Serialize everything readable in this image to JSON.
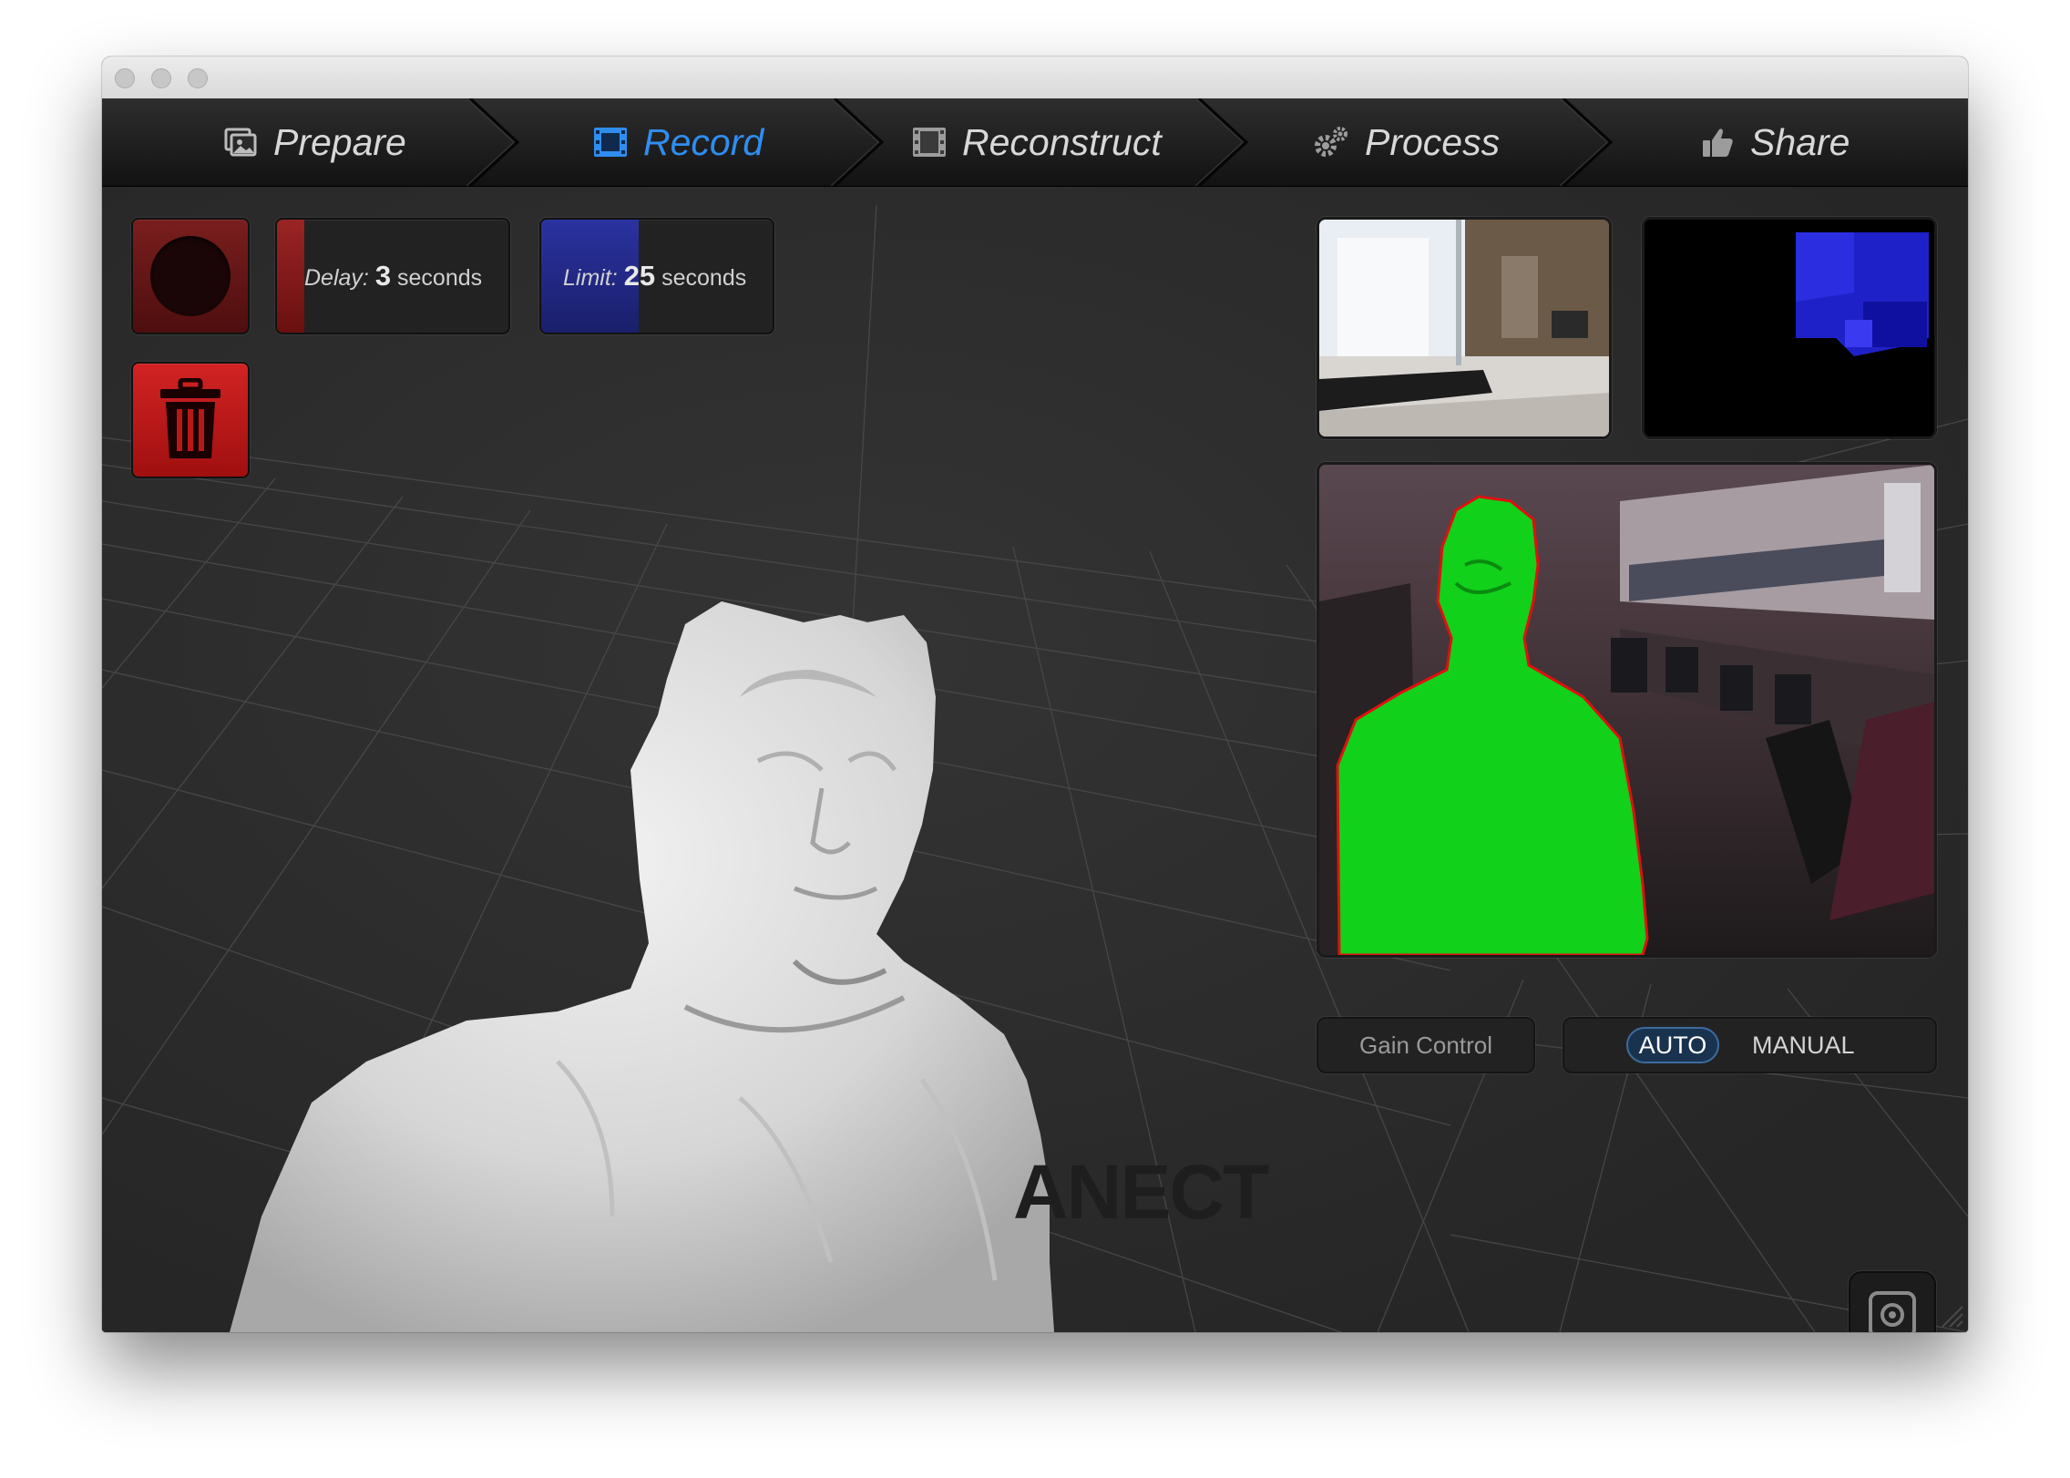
{
  "window": {
    "traffic_lights": [
      "close",
      "minimize",
      "zoom"
    ]
  },
  "tabs": [
    {
      "label": "Prepare",
      "icon": "photos-icon",
      "active": false
    },
    {
      "label": "Record",
      "icon": "film-frame-icon",
      "active": true
    },
    {
      "label": "Reconstruct",
      "icon": "film-strip-icon",
      "active": false
    },
    {
      "label": "Process",
      "icon": "gears-icon",
      "active": false
    },
    {
      "label": "Share",
      "icon": "thumbs-up-icon",
      "active": false
    }
  ],
  "controls": {
    "record_button": {
      "icon": "record-icon",
      "color": "#7a1e1e"
    },
    "delete_button": {
      "icon": "trash-icon",
      "color": "#d22323"
    },
    "delay": {
      "label": "Delay:",
      "value": "3",
      "unit": "seconds",
      "fill_fraction": 0.12,
      "color": "#8a1e1e"
    },
    "limit": {
      "label": "Limit:",
      "value": "25",
      "unit": "seconds",
      "fill_fraction": 0.42,
      "color": "#22298a"
    }
  },
  "previews": {
    "color_camera": "color-camera-preview",
    "depth_camera": "depth-camera-preview",
    "segmentation": "segmentation-preview"
  },
  "gain": {
    "label": "Gain Control",
    "options": [
      "AUTO",
      "MANUAL"
    ],
    "selected": "AUTO"
  },
  "viewport": {
    "watermark": "ANECT"
  },
  "snapshot_button": {
    "icon": "camera-icon"
  }
}
